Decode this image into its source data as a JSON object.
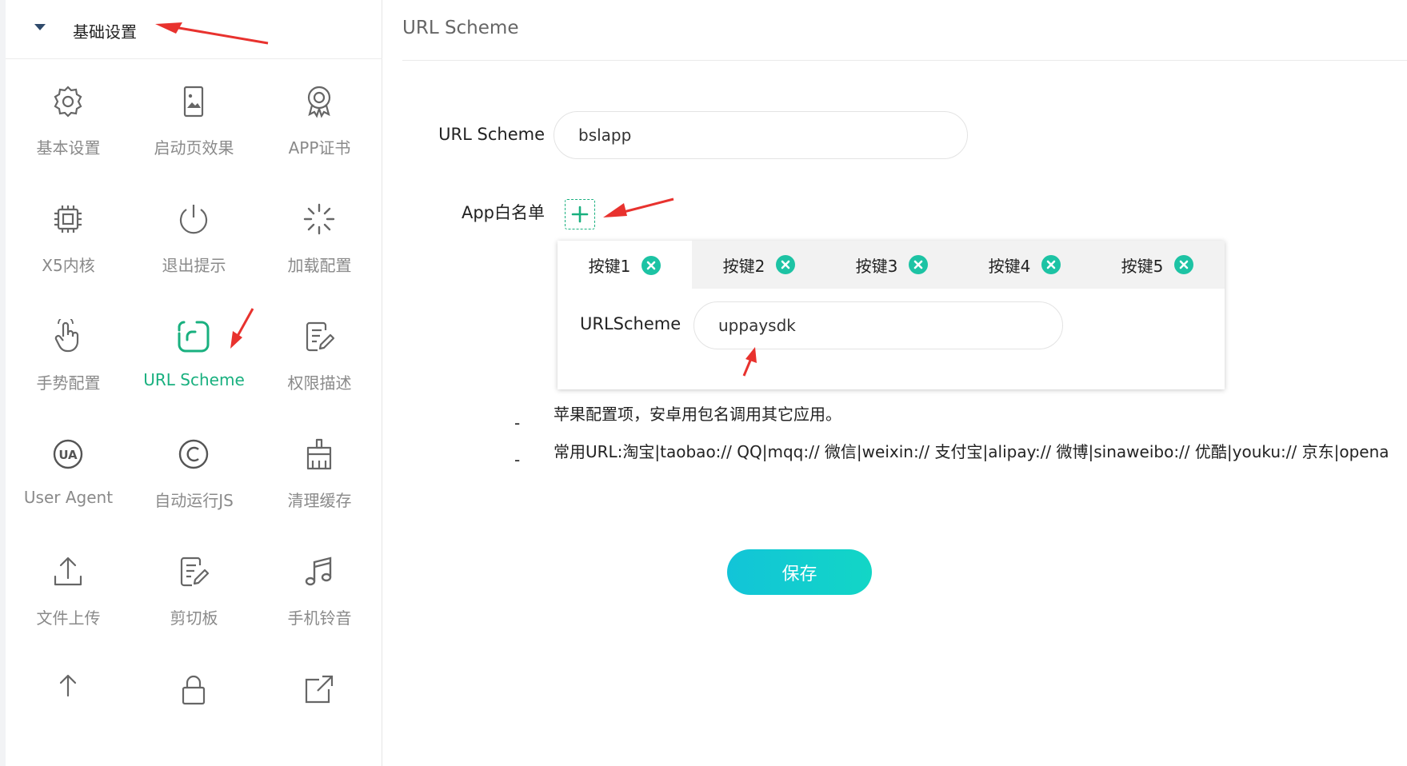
{
  "sidebar": {
    "title": "基础设置",
    "items": [
      {
        "label": "基本设置",
        "icon": "gear-icon"
      },
      {
        "label": "启动页效果",
        "icon": "phone-image-icon"
      },
      {
        "label": "APP证书",
        "icon": "certificate-icon"
      },
      {
        "label": "X5内核",
        "icon": "chip-icon"
      },
      {
        "label": "退出提示",
        "icon": "power-icon"
      },
      {
        "label": "加载配置",
        "icon": "loading-spinner-icon"
      },
      {
        "label": "手势配置",
        "icon": "hand-gesture-icon"
      },
      {
        "label": "URL Scheme",
        "icon": "url-scheme-icon",
        "active": true
      },
      {
        "label": "权限描述",
        "icon": "edit-document-icon"
      },
      {
        "label": "User Agent",
        "icon": "ua-icon"
      },
      {
        "label": "自动运行JS",
        "icon": "copyright-icon"
      },
      {
        "label": "清理缓存",
        "icon": "broom-icon"
      },
      {
        "label": "文件上传",
        "icon": "upload-icon"
      },
      {
        "label": "剪切板",
        "icon": "clipboard-edit-icon"
      },
      {
        "label": "手机铃音",
        "icon": "music-note-icon"
      }
    ]
  },
  "main": {
    "title": "URL Scheme",
    "url_scheme_label": "URL Scheme",
    "url_scheme_value": "bslapp",
    "whitelist_label": "App白名单",
    "tabs": [
      {
        "label": "按键1",
        "active": true
      },
      {
        "label": "按键2"
      },
      {
        "label": "按键3"
      },
      {
        "label": "按键4"
      },
      {
        "label": "按键5"
      }
    ],
    "tab_field_label": "URLScheme",
    "tab_field_value": "uppaysdk",
    "note1": "苹果配置项，安卓用包名调用其它应用。",
    "note2": "常用URL:淘宝|taobao:// QQ|mqq:// 微信|weixin:// 支付宝|alipay:// 微博|sinaweibo:// 优酷|youku:// 京东|opena",
    "dash": "-",
    "save_label": "保存"
  },
  "colors": {
    "accent": "#19b07f",
    "close": "#1dc3a4",
    "save_gradient_start": "#12c4d8",
    "save_gradient_end": "#12d6c6",
    "annotation": "#e8322e"
  }
}
